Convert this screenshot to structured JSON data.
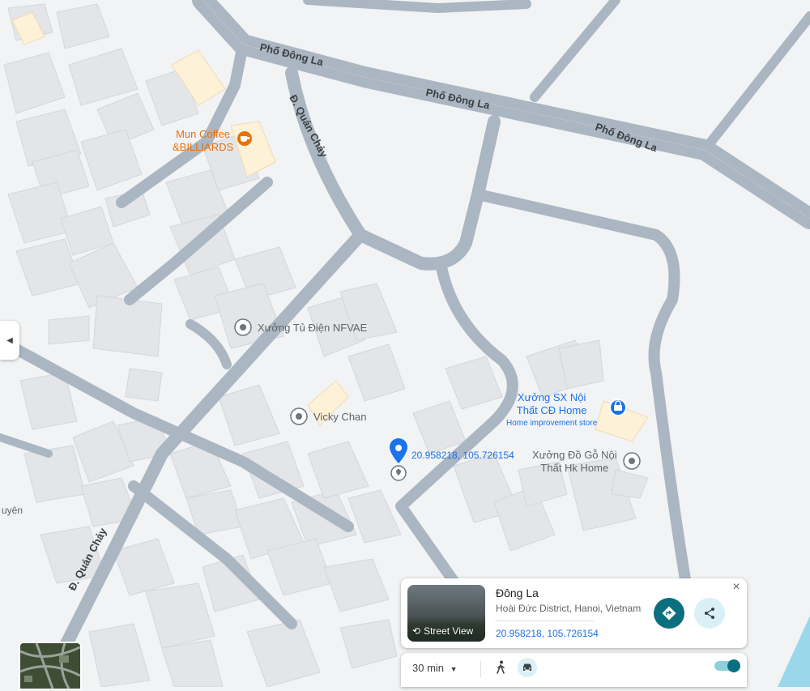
{
  "map": {
    "streets": {
      "pho_dong_la": "Phố Đông La",
      "quan_chay": "Đ. Quán Chảy"
    },
    "pois": {
      "mun_coffee_line1": "Mun Coffee",
      "mun_coffee_line2": "&BILLIARDS",
      "xuong_tu_dien": "Xưởng Tủ Điện NFVAE",
      "vicky_chan": "Vicky Chan",
      "xuong_sx_line1": "Xưởng SX Nội",
      "xuong_sx_line2": "Thất CĐ Home",
      "xuong_sx_category": "Home improvement store",
      "xuong_do_go_line1": "Xưởng Đồ Gỗ Nội",
      "xuong_do_go_line2": "Thất Hk Home",
      "edge_label": "uyên"
    },
    "dropped_pin_coords": "20.958218, 105.726154",
    "colors": {
      "road": "#aab6c2",
      "building": "#e3e5e8",
      "pin": "#1a73e8",
      "poi_orange": "#e8710a",
      "water": "#9ad7ea"
    }
  },
  "place_card": {
    "title": "Đông La",
    "subtitle": "Hoài Đức District, Hanoi, Vietnam",
    "coords": "20.958218, 105.726154",
    "street_view_label": "Street View",
    "close_label": "×"
  },
  "travel": {
    "time_label": "30 min"
  }
}
